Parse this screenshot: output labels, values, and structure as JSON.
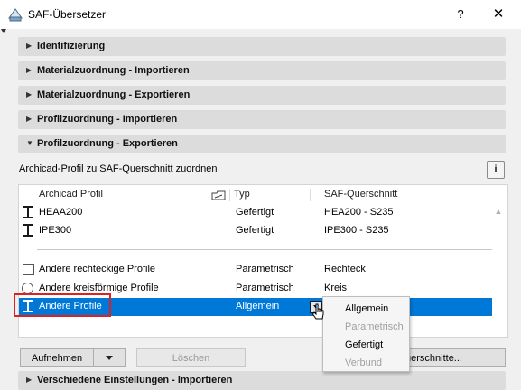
{
  "window": {
    "title": "SAF-Übersetzer",
    "help": "?",
    "close": "✕"
  },
  "sections": {
    "identifizierung": "Identifizierung",
    "material_import": "Materialzuordnung - Importieren",
    "material_export": "Materialzuordnung - Exportieren",
    "profil_import": "Profilzuordnung - Importieren",
    "profil_export": "Profilzuordnung - Exportieren",
    "misc_import": "Verschiedene Einstellungen - Importieren"
  },
  "arrows": {
    "collapsed": "▶",
    "expanded": "▼"
  },
  "profile_mapping": {
    "description": "Archicad-Profil zu SAF-Querschnitt zuordnen",
    "info_icon": "i",
    "columns": {
      "profile": "Archicad Profil",
      "type": "Typ",
      "saf": "SAF-Querschnitt"
    },
    "rows": [
      {
        "profile": "HEAA200",
        "type": "Gefertigt",
        "saf": "HEA200 - S235",
        "icon": "i-beam-icon"
      },
      {
        "profile": "IPE300",
        "type": "Gefertigt",
        "saf": "IPE300 - S235",
        "icon": "i-beam-icon"
      },
      {
        "profile": "Andere rechteckige Profile",
        "type": "Parametrisch",
        "saf": "Rechteck",
        "icon": "checkbox-icon"
      },
      {
        "profile": "Andere kreisförmige Profile",
        "type": "Parametrisch",
        "saf": "Kreis",
        "icon": "radio-icon"
      },
      {
        "profile": "Andere Profile",
        "type": "Allgemein",
        "saf": "",
        "icon": "i-beam-icon",
        "selected": true
      }
    ]
  },
  "type_menu": {
    "items": [
      {
        "label": "Allgemein",
        "enabled": true
      },
      {
        "label": "Parametrisch",
        "enabled": false
      },
      {
        "label": "Gefertigt",
        "enabled": true
      },
      {
        "label": "Verbund",
        "enabled": false
      }
    ]
  },
  "buttons": {
    "aufnehmen": "Aufnehmen",
    "loeschen": "Löschen",
    "querschnitte": "uerschnitte..."
  },
  "colors": {
    "selection": "#0078d7",
    "highlight_frame": "#e02020"
  }
}
